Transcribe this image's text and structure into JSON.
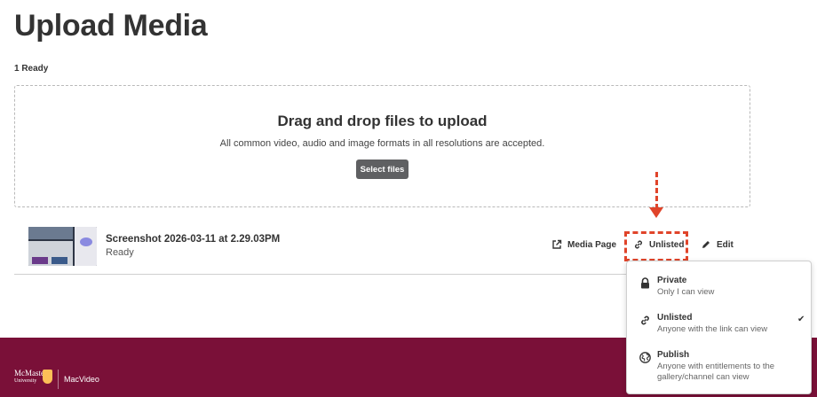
{
  "header": {
    "title": "Upload Media",
    "ready_count": "1 Ready"
  },
  "dropzone": {
    "title": "Drag and drop files to upload",
    "subtitle": "All common video, audio and image formats in all resolutions are accepted.",
    "select_button": "Select files"
  },
  "media": {
    "name": "Screenshot 2026-03-11 at 2.29.03PM",
    "status": "Ready",
    "actions": {
      "media_page": "Media Page",
      "visibility": "Unlisted",
      "edit": "Edit"
    }
  },
  "visibility_menu": {
    "selected": "Unlisted",
    "options": [
      {
        "label": "Private",
        "description": "Only I can view",
        "icon": "lock-icon"
      },
      {
        "label": "Unlisted",
        "description": "Anyone with the link can view",
        "icon": "link-icon",
        "check": "✔"
      },
      {
        "label": "Publish",
        "description": "Anyone with entitlements to the gallery/channel can view",
        "icon": "globe-icon"
      }
    ]
  },
  "footer": {
    "logo_name": "McMaster",
    "logo_sub": "University",
    "product": "MacVideo"
  },
  "colors": {
    "footer_bg": "#7a1038",
    "annotation": "#e0442a",
    "button_bg": "#5f6062"
  }
}
